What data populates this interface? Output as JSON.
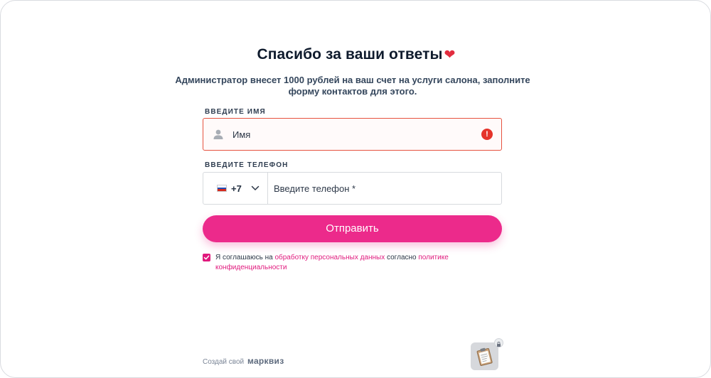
{
  "title": "Спасибо за ваши ответы",
  "subtitle": "Администратор внесет 1000 рублей на ваш счет на услуги салона, заполните форму контактов для этого.",
  "name_field": {
    "label": "ВВЕДИТЕ ИМЯ",
    "placeholder": "Имя",
    "state": "error",
    "error_glyph": "!"
  },
  "phone_field": {
    "label": "ВВЕДИТЕ ТЕЛЕФОН",
    "country_code": "+7",
    "placeholder": "Введите телефон *"
  },
  "submit_button": {
    "label": "Отправить"
  },
  "consent": {
    "checked": true,
    "text_before": "Я соглашаюсь на ",
    "link1": "обработку персональных данных",
    "text_middle": " согласно ",
    "link2": "политике конфиденциальности"
  },
  "footer": {
    "prefix": "Создай свой",
    "brand": "марквиз"
  },
  "colors": {
    "accent": "#ec2a8b",
    "error": "#e5332a",
    "heading": "#0f1b2d"
  },
  "icons": [
    "heart-icon",
    "user-icon",
    "error-icon",
    "russia-flag-icon",
    "chevron-down-icon",
    "checkmark-icon",
    "clipboard-icon",
    "lock-icon"
  ]
}
